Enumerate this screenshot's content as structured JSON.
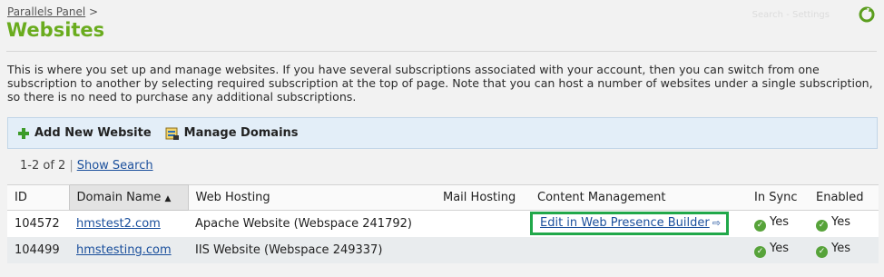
{
  "breadcrumb": {
    "root": "Parallels Panel",
    "separator": ">"
  },
  "page": {
    "title": "Websites"
  },
  "top_right": {
    "link_text": "Search - Settings"
  },
  "description": "This is where you set up and manage websites. If you have several subscriptions associated with your account, then you can switch from one subscription to another by selecting required subscription at the top of page. Note that you can host a number of websites under a single subscription, so there is no need to purchase any additional subscriptions.",
  "toolbar": {
    "add_label": "Add New Website",
    "manage_label": "Manage Domains"
  },
  "pager": {
    "count": "1-2 of 2",
    "show_search": "Show Search"
  },
  "table": {
    "columns": [
      "ID",
      "Domain Name",
      "Web Hosting",
      "Mail Hosting",
      "Content Management",
      "In Sync",
      "Enabled"
    ],
    "sorted_column": "Domain Name",
    "rows": [
      {
        "id": "104572",
        "domain": "hmstest2.com",
        "web_hosting": "Apache Website (Webspace 241792)",
        "mail_hosting": "",
        "content_management": "Edit in Web Presence Builder",
        "in_sync": "Yes",
        "enabled": "Yes"
      },
      {
        "id": "104499",
        "domain": "hmstesting.com",
        "web_hosting": "IIS Website (Webspace 249337)",
        "mail_hosting": "",
        "content_management": "",
        "in_sync": "Yes",
        "enabled": "Yes"
      }
    ]
  },
  "colors": {
    "title_green": "#6aac1e",
    "link_blue": "#1a4f9c",
    "highlight_green": "#21a84a",
    "toolbar_bg": "#e3eef8"
  }
}
